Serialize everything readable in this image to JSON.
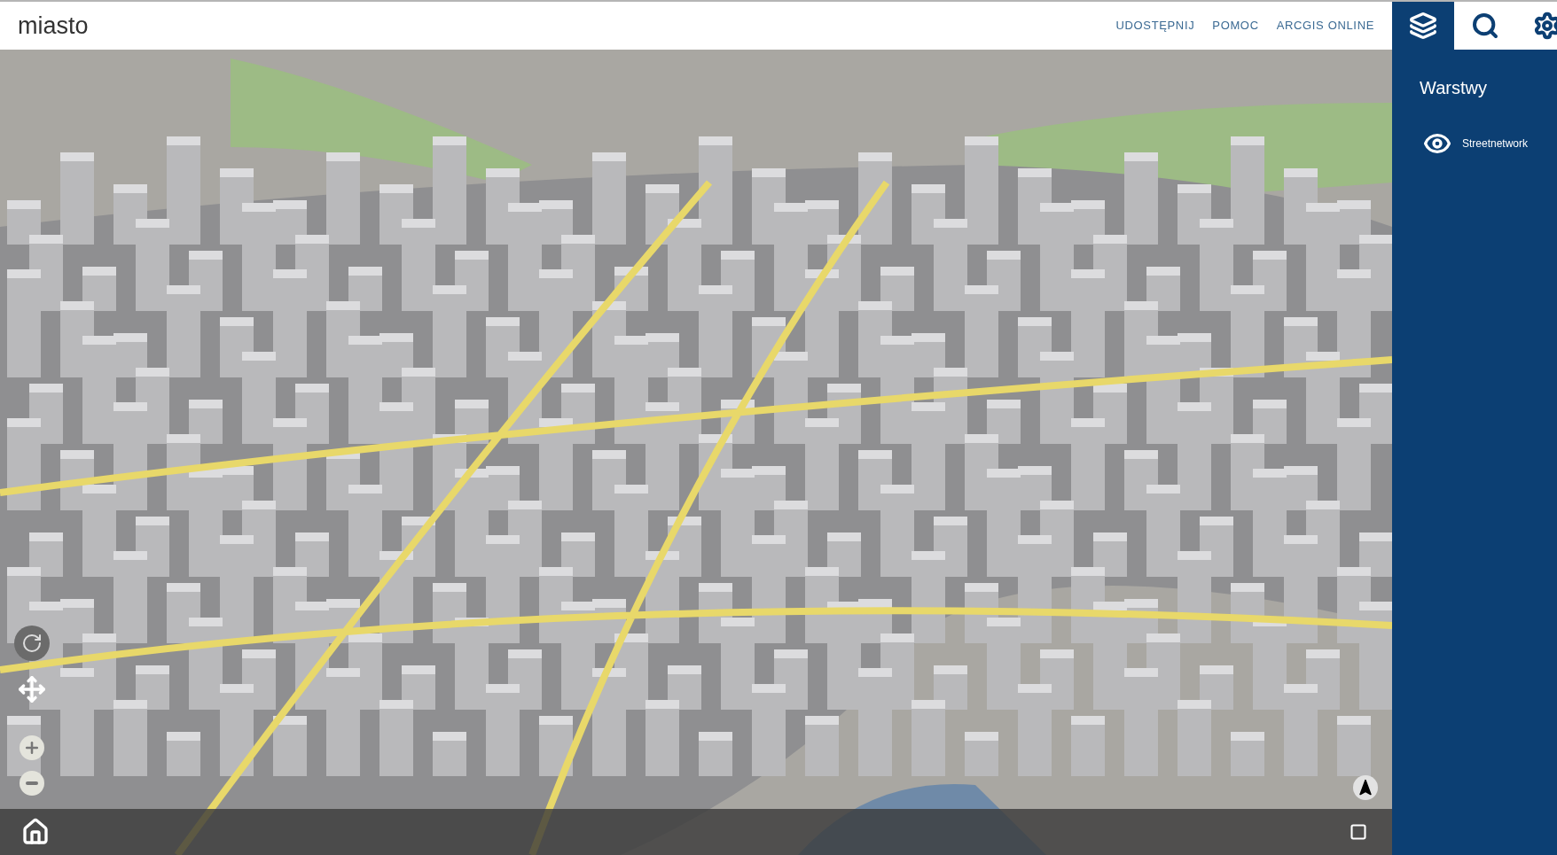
{
  "header": {
    "title": "miasto",
    "links": [
      "UDOSTĘPNIJ",
      "POMOC",
      "ARCGIS ONLINE"
    ]
  },
  "sidebar": {
    "tabs": [
      {
        "kind": "layers",
        "selected": true
      },
      {
        "kind": "search",
        "selected": false
      },
      {
        "kind": "settings",
        "selected": false
      }
    ],
    "panel_title": "Warstwy",
    "layers": [
      {
        "name": "Streetnetwork",
        "visible": true
      }
    ]
  }
}
